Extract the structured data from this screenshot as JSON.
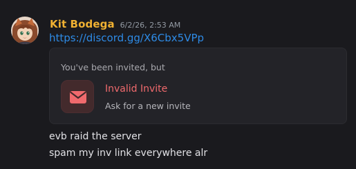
{
  "message": {
    "author": "Kit Bodega",
    "timestamp": "6/2/26, 2:53 AM",
    "avatar_icon": "fox-avatar",
    "link_text": "https://discord.gg/X6Cbx5VPp",
    "lines": [
      "evb raid the server",
      "spam my inv link everywhere alr"
    ]
  },
  "invite_embed": {
    "header": "You've been invited, but",
    "title": "Invalid Invite",
    "subtitle": "Ask for a new invite",
    "icon": "envelope-icon"
  },
  "colors": {
    "username": "#f0b132",
    "link": "#2e8be6",
    "invalid_title": "#f06a6d",
    "icon_accent": "#f06a6d",
    "background": "#1a1a1e",
    "card_background": "#232328"
  }
}
